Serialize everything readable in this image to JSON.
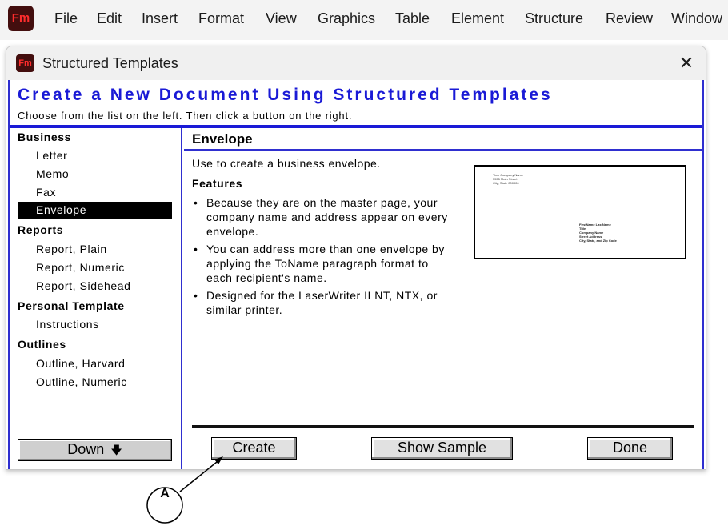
{
  "app": {
    "logo_text": "Fm",
    "menu": [
      "File",
      "Edit",
      "Insert",
      "Format",
      "View",
      "Graphics",
      "Table",
      "Element",
      "Structure",
      "Review",
      "Window"
    ]
  },
  "dialog": {
    "title": "Structured Templates",
    "close_glyph": "✕",
    "header_title": "Create a New Document Using Structured Templates",
    "header_subtitle": "Choose from the list on the left. Then click a button on the right.",
    "sidebar": {
      "categories": [
        {
          "label": "Business",
          "items": [
            "Letter",
            "Memo",
            "Fax",
            "Envelope"
          ]
        },
        {
          "label": "Reports",
          "items": [
            "Report, Plain",
            "Report, Numeric",
            "Report, Sidehead"
          ]
        },
        {
          "label": "Personal Template",
          "items": [
            "Instructions"
          ]
        },
        {
          "label": "Outlines",
          "items": [
            "Outline, Harvard",
            "Outline, Numeric"
          ]
        }
      ],
      "selected": "Envelope",
      "down_label": "Down",
      "down_arrow": "🡇"
    },
    "main": {
      "title": "Envelope",
      "description": "Use to create a business envelope.",
      "features_heading": "Features",
      "features": [
        "Because they are on the master page, your company name and address appear on every envelope.",
        "You can address more than one envelope by applying the ToName paragraph format to each recipient's name.",
        "Designed for the LaserWriter II NT, NTX, or similar printer."
      ],
      "sample": {
        "return_address": [
          "Your Company Name",
          "5555 Main Street",
          "City, State 000000"
        ],
        "to_address": [
          "FirstName LastName",
          "Title",
          "Company Name",
          "Street Address",
          "City, State, and Zip Code"
        ]
      },
      "buttons": {
        "create": "Create",
        "show_sample": "Show Sample",
        "done": "Done"
      }
    }
  },
  "annotation": {
    "label": "A"
  },
  "colors": {
    "accent_blue": "#1a1ad6",
    "frame_blue": "#2f2fd0",
    "selected_bg": "#000000",
    "logo_bg": "#430e0e",
    "logo_fg": "#ff2d2d"
  }
}
